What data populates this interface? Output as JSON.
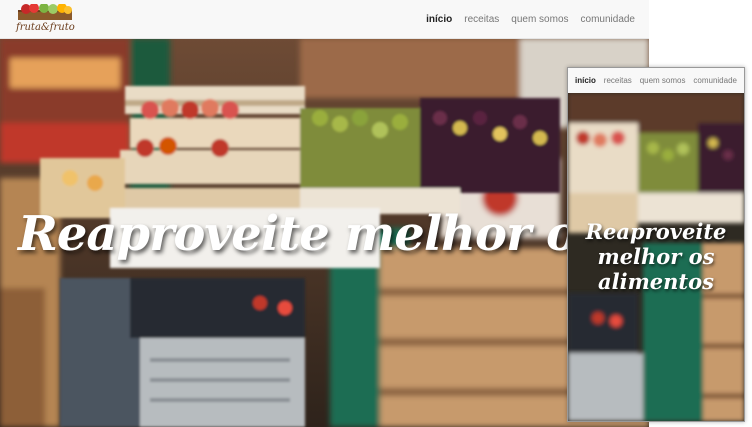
{
  "brand": {
    "name": "fruta&fruto",
    "logo_icon": "fruit-crate-icon"
  },
  "nav": {
    "items": [
      {
        "label": "início",
        "active": true
      },
      {
        "label": "receitas",
        "active": false
      },
      {
        "label": "quem somos",
        "active": false
      },
      {
        "label": "comunidade",
        "active": false
      }
    ]
  },
  "hero": {
    "headline": "Reaproveite melhor os alimentos",
    "background": "market-stall-photo"
  },
  "colors": {
    "nav_bg": "#f8f8f8",
    "active_link": "#222222",
    "link": "#777777",
    "headline": "#ffffff"
  }
}
